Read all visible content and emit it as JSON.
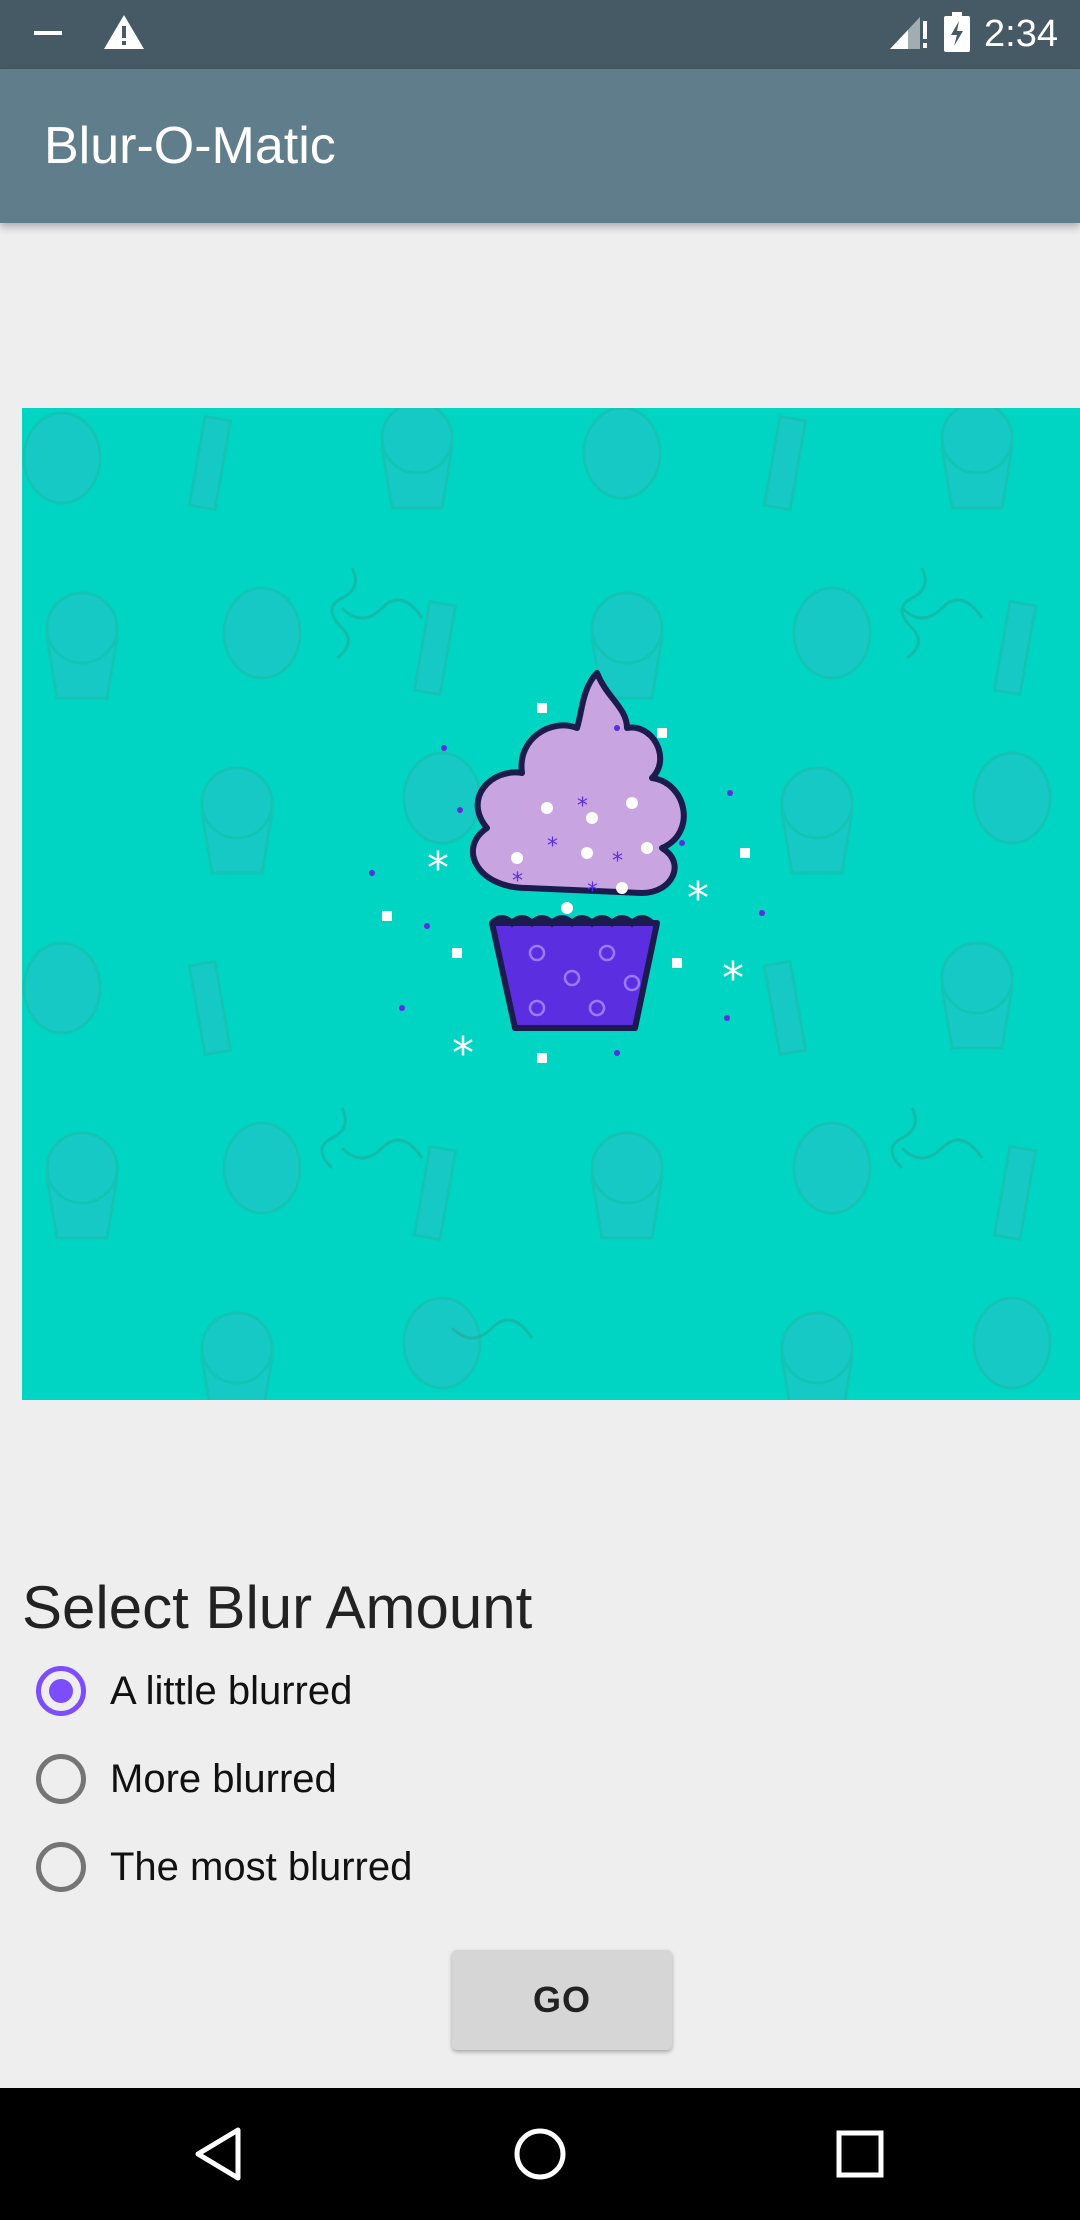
{
  "status_bar": {
    "time": "2:34",
    "icons": [
      "notification-dash-icon",
      "warning-icon",
      "signal-icon",
      "battery-charging-icon"
    ]
  },
  "app_bar": {
    "title": "Blur-O-Matic"
  },
  "image": {
    "description": "cupcake",
    "background_color": "#00d4c2"
  },
  "blur_section": {
    "title": "Select Blur Amount",
    "options": [
      {
        "label": "A little blurred",
        "checked": true
      },
      {
        "label": "More blurred",
        "checked": false
      },
      {
        "label": "The most blurred",
        "checked": false
      }
    ]
  },
  "go_button": {
    "label": "GO"
  },
  "nav_bar": {
    "icons": [
      "back-icon",
      "home-icon",
      "recents-icon"
    ]
  },
  "colors": {
    "accent": "#7c4dff",
    "app_bar": "#607d8b",
    "status_bar": "#455a64"
  }
}
